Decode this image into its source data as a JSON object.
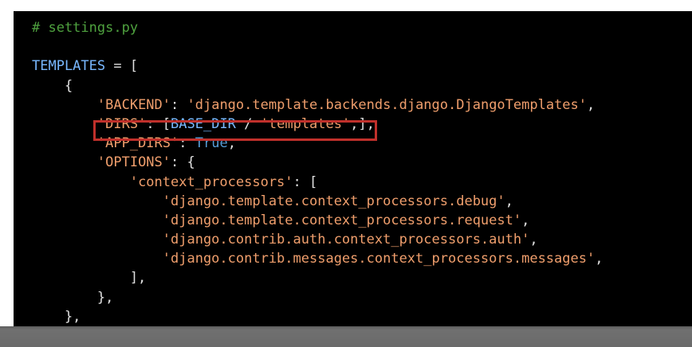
{
  "code": {
    "language": "python",
    "lines": [
      [
        {
          "t": "# settings.py",
          "c": "cm"
        }
      ],
      [],
      [
        {
          "t": "TEMPLATES",
          "c": "idt"
        },
        {
          "t": " = [",
          "c": "op"
        }
      ],
      [
        {
          "t": "    {",
          "c": "op"
        }
      ],
      [
        {
          "t": "        ",
          "c": "op"
        },
        {
          "t": "'BACKEND'",
          "c": "str"
        },
        {
          "t": ": ",
          "c": "op"
        },
        {
          "t": "'django.template.backends.django.DjangoTemplates'",
          "c": "str"
        },
        {
          "t": ",",
          "c": "op"
        }
      ],
      [
        {
          "t": "        ",
          "c": "op"
        },
        {
          "t": "'DIRS'",
          "c": "str"
        },
        {
          "t": ": [",
          "c": "op"
        },
        {
          "t": "BASE_DIR",
          "c": "idt"
        },
        {
          "t": " / ",
          "c": "op"
        },
        {
          "t": "'templates'",
          "c": "str"
        },
        {
          "t": ",],",
          "c": "op"
        }
      ],
      [
        {
          "t": "        ",
          "c": "op"
        },
        {
          "t": "'APP_DIRS'",
          "c": "str"
        },
        {
          "t": ": ",
          "c": "op"
        },
        {
          "t": "True",
          "c": "kw"
        },
        {
          "t": ",",
          "c": "op"
        }
      ],
      [
        {
          "t": "        ",
          "c": "op"
        },
        {
          "t": "'OPTIONS'",
          "c": "str"
        },
        {
          "t": ": {",
          "c": "op"
        }
      ],
      [
        {
          "t": "            ",
          "c": "op"
        },
        {
          "t": "'context_processors'",
          "c": "str"
        },
        {
          "t": ": [",
          "c": "op"
        }
      ],
      [
        {
          "t": "                ",
          "c": "op"
        },
        {
          "t": "'django.template.context_processors.debug'",
          "c": "str"
        },
        {
          "t": ",",
          "c": "op"
        }
      ],
      [
        {
          "t": "                ",
          "c": "op"
        },
        {
          "t": "'django.template.context_processors.request'",
          "c": "str"
        },
        {
          "t": ",",
          "c": "op"
        }
      ],
      [
        {
          "t": "                ",
          "c": "op"
        },
        {
          "t": "'django.contrib.auth.context_processors.auth'",
          "c": "str"
        },
        {
          "t": ",",
          "c": "op"
        }
      ],
      [
        {
          "t": "                ",
          "c": "op"
        },
        {
          "t": "'django.contrib.messages.context_processors.messages'",
          "c": "str"
        },
        {
          "t": ",",
          "c": "op"
        }
      ],
      [
        {
          "t": "            ],",
          "c": "op"
        }
      ],
      [
        {
          "t": "        },",
          "c": "op"
        }
      ],
      [
        {
          "t": "    },",
          "c": "op"
        }
      ]
    ]
  },
  "highlight": {
    "line_index": 5,
    "color": "#c0302b"
  }
}
